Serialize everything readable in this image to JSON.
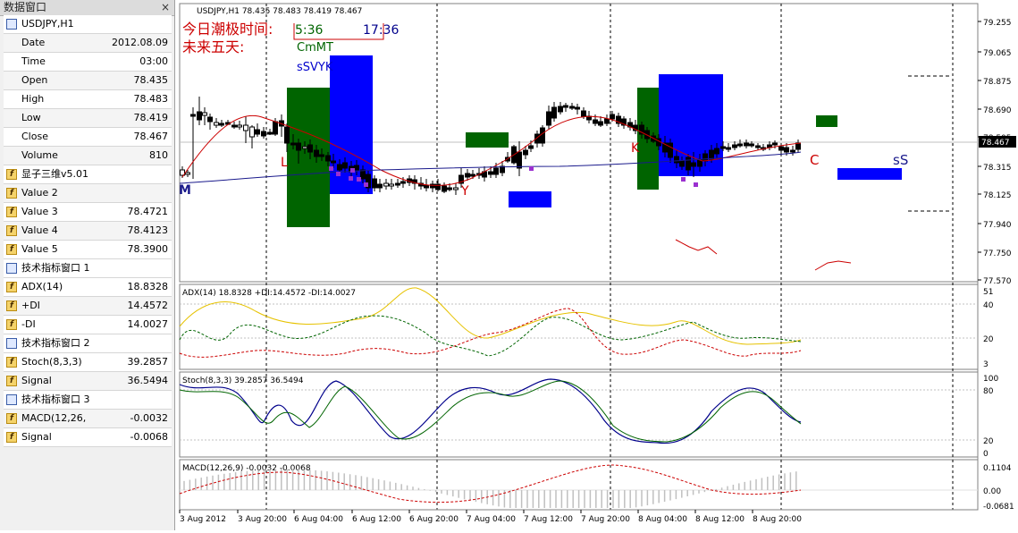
{
  "data_window": {
    "title": "数据窗口",
    "close_glyph": "×",
    "rows": [
      {
        "label": "USDJPY,H1",
        "value": "",
        "icon": "chart-window-icon",
        "kind": "section"
      },
      {
        "label": "Date",
        "value": "2012.08.09",
        "icon": "",
        "kind": "data"
      },
      {
        "label": "Time",
        "value": "03:00",
        "icon": "",
        "kind": "data"
      },
      {
        "label": "Open",
        "value": "78.435",
        "icon": "",
        "kind": "data"
      },
      {
        "label": "High",
        "value": "78.483",
        "icon": "",
        "kind": "data"
      },
      {
        "label": "Low",
        "value": "78.419",
        "icon": "",
        "kind": "data"
      },
      {
        "label": "Close",
        "value": "78.467",
        "icon": "",
        "kind": "data"
      },
      {
        "label": "Volume",
        "value": "810",
        "icon": "",
        "kind": "data"
      },
      {
        "label": "显子三维v5.01",
        "value": "",
        "icon": "custom-indicator-icon",
        "kind": "data"
      },
      {
        "label": "Value 2",
        "value": "",
        "icon": "custom-indicator-icon",
        "kind": "data"
      },
      {
        "label": "Value 3",
        "value": "78.4721",
        "icon": "custom-indicator-icon",
        "kind": "data"
      },
      {
        "label": "Value 4",
        "value": "78.4123",
        "icon": "custom-indicator-icon",
        "kind": "data"
      },
      {
        "label": "Value 5",
        "value": "78.3900",
        "icon": "custom-indicator-icon",
        "kind": "data"
      },
      {
        "label": "技术指标窗口 1",
        "value": "",
        "icon": "indicator-window-icon",
        "kind": "section"
      },
      {
        "label": "ADX(14)",
        "value": "18.8328",
        "icon": "function-icon",
        "kind": "data"
      },
      {
        "label": "+DI",
        "value": "14.4572",
        "icon": "function-icon",
        "kind": "data"
      },
      {
        "label": "-DI",
        "value": "14.0027",
        "icon": "function-icon",
        "kind": "data"
      },
      {
        "label": "技术指标窗口 2",
        "value": "",
        "icon": "indicator-window-icon",
        "kind": "section"
      },
      {
        "label": "Stoch(8,3,3)",
        "value": "39.2857",
        "icon": "function-icon",
        "kind": "data"
      },
      {
        "label": "Signal",
        "value": "36.5494",
        "icon": "function-icon",
        "kind": "data"
      },
      {
        "label": "技术指标窗口 3",
        "value": "",
        "icon": "indicator-window-icon",
        "kind": "section"
      },
      {
        "label": "MACD(12,26,",
        "value": "-0.0032",
        "icon": "function-icon",
        "kind": "data"
      },
      {
        "label": "Signal",
        "value": "-0.0068",
        "icon": "function-icon",
        "kind": "data"
      }
    ]
  },
  "chart": {
    "header": "USDJPY,H1  78.435 78.483 78.419 78.467",
    "overlay_line1": "今日潮极时间:",
    "overlay_line2": "未来五天:",
    "time1": "5:36",
    "time2": "17:36",
    "label_cmmt": "CmMT",
    "label_svyk": "sSVYK",
    "letters": {
      "L": "L",
      "Y": "Y",
      "K": "K",
      "M": "M",
      "C": "C",
      "S": "sS"
    },
    "price_current": "78.467",
    "price_ticks": [
      "79.255",
      "79.065",
      "78.875",
      "78.690",
      "78.505",
      "78.315",
      "78.125",
      "77.940",
      "77.750",
      "77.570"
    ],
    "adx_header": "ADX(14) 18.8328 +DI:14.4572 -DI:14.0027",
    "adx_ticks": [
      "51",
      "40",
      "20",
      "3"
    ],
    "stoch_header": "Stoch(8,3,3) 39.2857 36.5494",
    "stoch_ticks": [
      "100",
      "80",
      "20",
      "0"
    ],
    "macd_header": "MACD(12,26,9) -0.0032 -0.0068",
    "macd_ticks": [
      "0.1104",
      "0.00",
      "-0.0681"
    ],
    "time_labels": [
      "3 Aug 2012",
      "3 Aug 20:00",
      "6 Aug 04:00",
      "6 Aug 12:00",
      "6 Aug 20:00",
      "7 Aug 04:00",
      "7 Aug 12:00",
      "7 Aug 20:00",
      "8 Aug 04:00",
      "8 Aug 12:00",
      "8 Aug 20:00"
    ]
  },
  "colors": {
    "candle": "#000000",
    "ma_red": "#cc0000",
    "ma_blue": "#1a1a8c",
    "box_green": "#006400",
    "box_blue": "#0000ff",
    "adx_yellow": "#e6c200",
    "di_plus_green": "#006400",
    "di_minus_red": "#cc0000",
    "stoch_main": "#00008b",
    "stoch_signal": "#006400",
    "macd_hist": "#c0c0c0",
    "macd_signal": "#cc0000",
    "price_tag_bg": "#000000"
  }
}
